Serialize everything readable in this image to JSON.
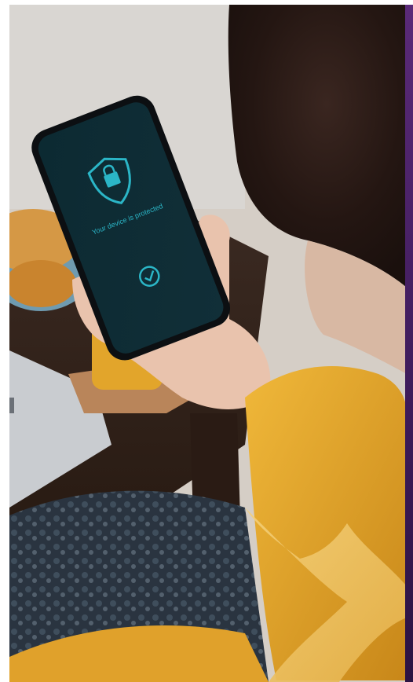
{
  "scene": {
    "phone": {
      "message": "Your device is protected",
      "icons": [
        "shield-lock-icon",
        "checkmark-circle-icon"
      ]
    },
    "colors": {
      "accent_teal": "#2bb6c7",
      "sleeve_yellow": "#e2a62a",
      "brand_purple": "#4b2368",
      "phone_screen": "#0f2b33"
    }
  }
}
